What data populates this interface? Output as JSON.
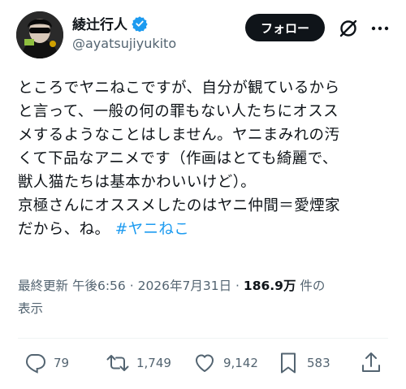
{
  "author": {
    "display_name": "綾辻行人",
    "handle": "@ayatsujiyukito",
    "verified_icon": "verified-badge-icon"
  },
  "header": {
    "follow_label": "フォロー",
    "grok_icon": "grok-icon",
    "more_icon": "more-options-icon"
  },
  "tweet": {
    "lines": [
      "ところでヤニねこですが、自分が観ているから",
      "と言って、一般の何の罪もない人たちにオスス",
      "メするようなことはしません。ヤニまみれの汚",
      "くて下品なアニメです（作画はとても綺麗で、",
      "獣人猫たちは基本かわいいけど）。",
      "京極さんにオススメしたのはヤニ仲間＝愛煙家",
      "だから、ね。"
    ],
    "hashtag": "#ヤニねこ"
  },
  "meta": {
    "edited": "最終更新",
    "time": "午後6:56",
    "sep1": "·",
    "date": "2026年7月31日",
    "sep2": "·",
    "views_count": "186.9万",
    "views_label_1": "件の",
    "views_label_2": "表示"
  },
  "actions": {
    "replies": "79",
    "reposts": "1,749",
    "likes": "9,142",
    "bookmarks": "583"
  },
  "colors": {
    "text": "#0f1419",
    "secondary": "#536471",
    "accent": "#1d9bf0",
    "divider": "#eff3f4"
  }
}
